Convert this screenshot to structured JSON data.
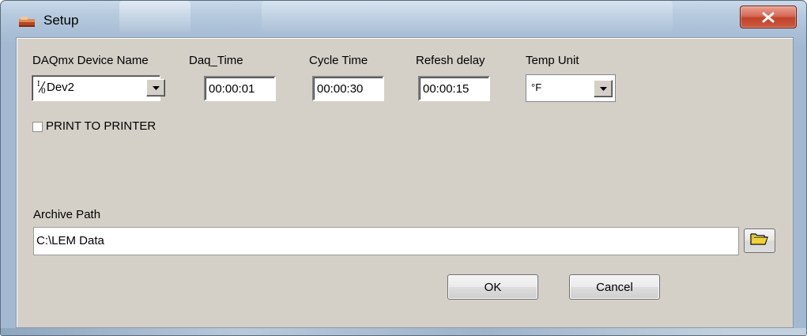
{
  "window": {
    "title": "Setup",
    "close_icon": "close-x-icon",
    "app_icon": "setup-app-icon"
  },
  "fields": {
    "device": {
      "label": "DAQmx Device Name",
      "value": "Dev2",
      "glyph": "I/O"
    },
    "daq_time": {
      "label": "Daq_Time",
      "value": "00:00:01"
    },
    "cycle_time": {
      "label": "Cycle Time",
      "value": "00:00:30"
    },
    "refresh_delay": {
      "label": "Refesh delay",
      "value": "00:00:15"
    },
    "temp_unit": {
      "label": "Temp Unit",
      "value": "°F"
    }
  },
  "print": {
    "label": "PRINT TO PRINTER",
    "checked": false
  },
  "archive": {
    "label": "Archive Path",
    "value": "C:\\LEM Data",
    "browse_icon": "folder-open-icon"
  },
  "buttons": {
    "ok": "OK",
    "cancel": "Cancel"
  },
  "colors": {
    "client_bg": "#d4d0c8",
    "close_red": "#c1432c",
    "frame_blue": "#a9bfd6"
  }
}
